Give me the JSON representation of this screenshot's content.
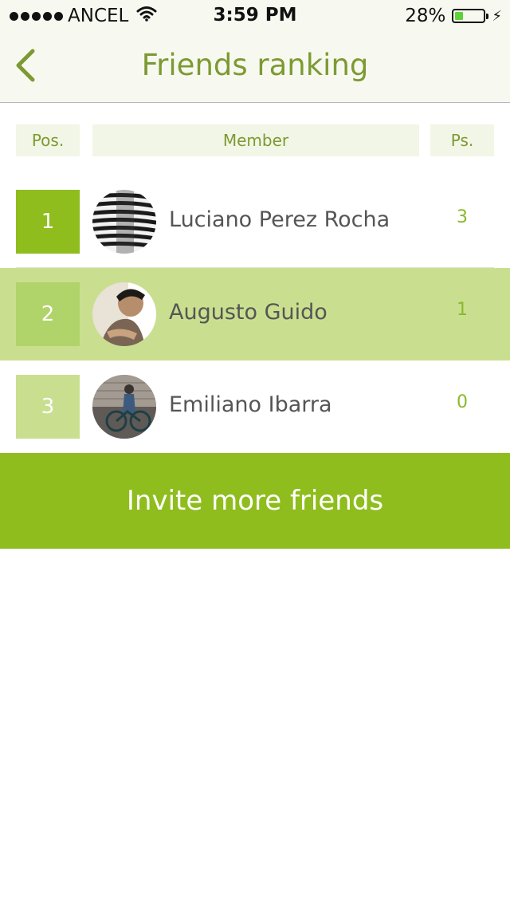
{
  "status_bar": {
    "carrier": "ANCEL",
    "time": "3:59 PM",
    "battery": "28%",
    "battery_level": 0.28
  },
  "nav": {
    "title": "Friends ranking"
  },
  "table": {
    "headers": {
      "pos": "Pos.",
      "member": "Member",
      "points": "Ps."
    },
    "rows": [
      {
        "pos": "1",
        "name": "Luciano Perez Rocha",
        "points": "3"
      },
      {
        "pos": "2",
        "name": "Augusto Guido",
        "points": "1"
      },
      {
        "pos": "3",
        "name": "Emiliano Ibarra",
        "points": "0"
      }
    ]
  },
  "invite": {
    "label": "Invite more friends"
  },
  "colors": {
    "accent": "#8fbd1d",
    "title_green": "#7d9a32",
    "highlight_row": "#c9df8f",
    "pos1_box": "#8fbd1d",
    "pos2_box": "#b0d36a",
    "pos3_box": "#c9df8f"
  },
  "icons": {
    "back": "chevron-left-icon",
    "wifi": "wifi-icon",
    "battery": "battery-icon",
    "charging": "bolt-icon"
  }
}
